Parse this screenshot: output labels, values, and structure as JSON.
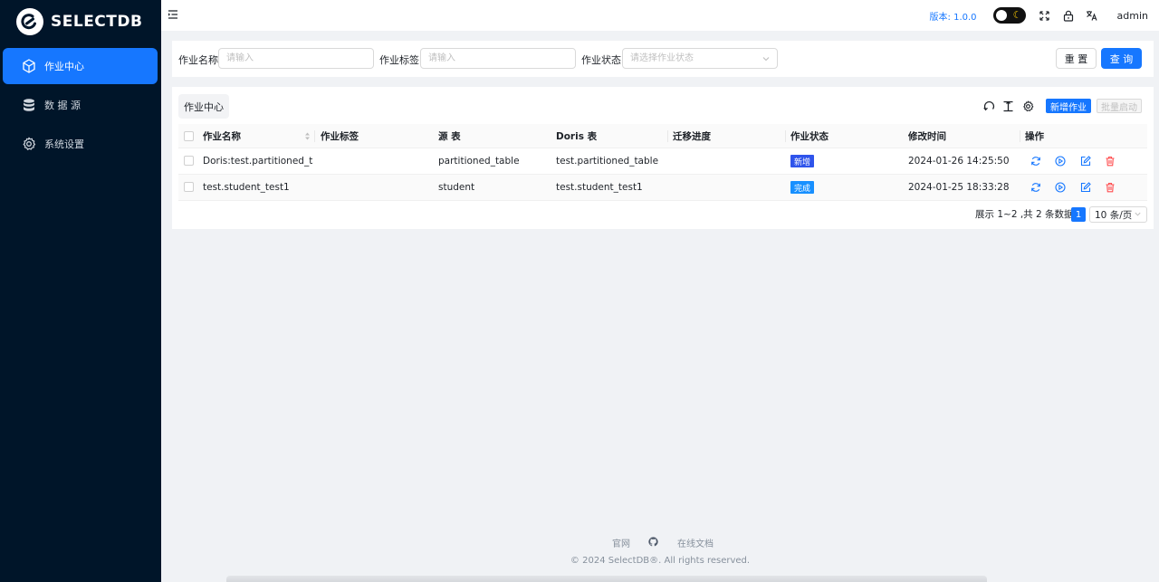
{
  "brand": {
    "name": "SELECTDB"
  },
  "sidebar": {
    "items": [
      {
        "label": "作业中心",
        "icon": "cube-icon",
        "active": true
      },
      {
        "label": "数 据 源",
        "icon": "database-icon",
        "active": false
      },
      {
        "label": "系统设置",
        "icon": "gear-icon",
        "active": false
      }
    ]
  },
  "header": {
    "version": "版本: 1.0.0",
    "user": "admin"
  },
  "filter": {
    "name_label": "作业名称",
    "name_placeholder": "请输入",
    "tag_label": "作业标签",
    "tag_placeholder": "请输入",
    "status_label": "作业状态",
    "status_placeholder": "请选择作业状态",
    "reset_label": "重 置",
    "query_label": "查 询"
  },
  "card": {
    "tab_label": "作业中心",
    "new_job_label": "新增作业",
    "batch_start_label": "批量启动"
  },
  "table": {
    "columns": [
      "作业名称",
      "作业标签",
      "源 表",
      "Doris 表",
      "迁移进度",
      "作业状态",
      "修改时间",
      "操作"
    ],
    "rows": [
      {
        "name": "Doris:test.partitioned_ta...",
        "tag": "",
        "source": "partitioned_table",
        "doris": "test.partitioned_table",
        "progress": "",
        "status": "新增",
        "status_color": "#2f54eb",
        "modified": "2024-01-26 14:25:50"
      },
      {
        "name": "test.student_test1",
        "tag": "",
        "source": "student",
        "doris": "test.student_test1",
        "progress": "",
        "status": "完成",
        "status_color": "#1890ff",
        "modified": "2024-01-25 18:33:28"
      }
    ]
  },
  "pagination": {
    "summary": "展示 1~2 ,共 2 条数据",
    "current_page": "1",
    "page_size": "10 条/页"
  },
  "footer": {
    "link_official": "官网",
    "link_docs": "在线文档",
    "copyright": "© 2024 SelectDB®. All rights reserved."
  },
  "colors": {
    "primary": "#1677ff",
    "sidebar_bg": "#001529",
    "danger": "#ff4d4f"
  }
}
